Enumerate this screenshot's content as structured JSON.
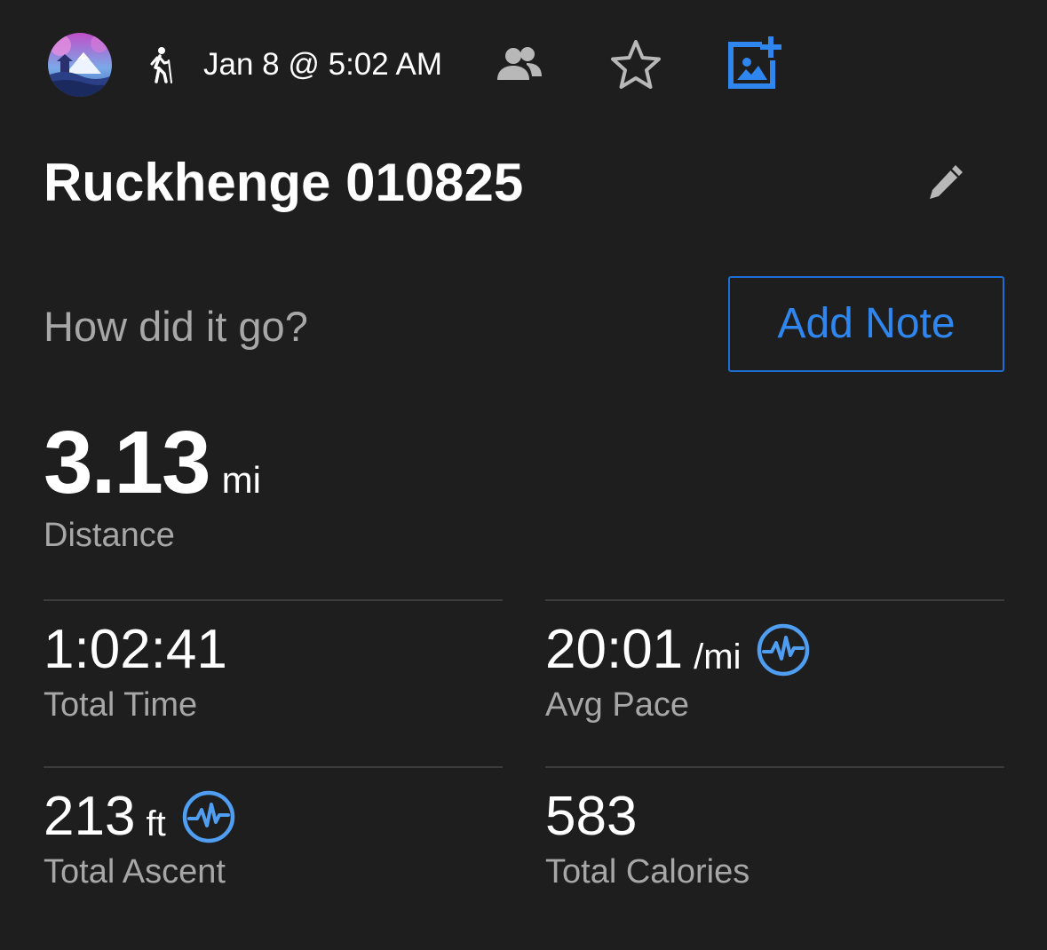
{
  "header": {
    "avatar_icon": "profile-avatar-mountain",
    "activity_type_icon": "hiking-icon",
    "timestamp": "Jan 8 @ 5:02 AM",
    "share_icon": "people-icon",
    "favorite_icon": "star-outline-icon",
    "add_photo_icon": "add-photo-icon"
  },
  "activity": {
    "title": "Ruckhenge 010825",
    "edit_icon": "pencil-icon"
  },
  "note": {
    "prompt": "How did it go?",
    "button_label": "Add Note"
  },
  "distance": {
    "value": "3.13",
    "unit": "mi",
    "label": "Distance"
  },
  "stats": {
    "total_time": {
      "value": "1:02:41",
      "label": "Total Time"
    },
    "avg_pace": {
      "value": "20:01",
      "unit": "/mi",
      "label": "Avg Pace",
      "badge_icon": "activity-pulse-icon"
    },
    "total_ascent": {
      "value": "213",
      "unit": "ft",
      "label": "Total Ascent",
      "badge_icon": "activity-pulse-icon"
    },
    "total_calories": {
      "value": "583",
      "label": "Total Calories"
    }
  },
  "colors": {
    "background": "#1e1e1e",
    "accent_blue": "#2f86ef",
    "badge_blue": "#4f9ef2",
    "secondary_text": "#a7a7a7",
    "icon_gray": "#b8b8b8",
    "divider": "#3c3c3c"
  }
}
